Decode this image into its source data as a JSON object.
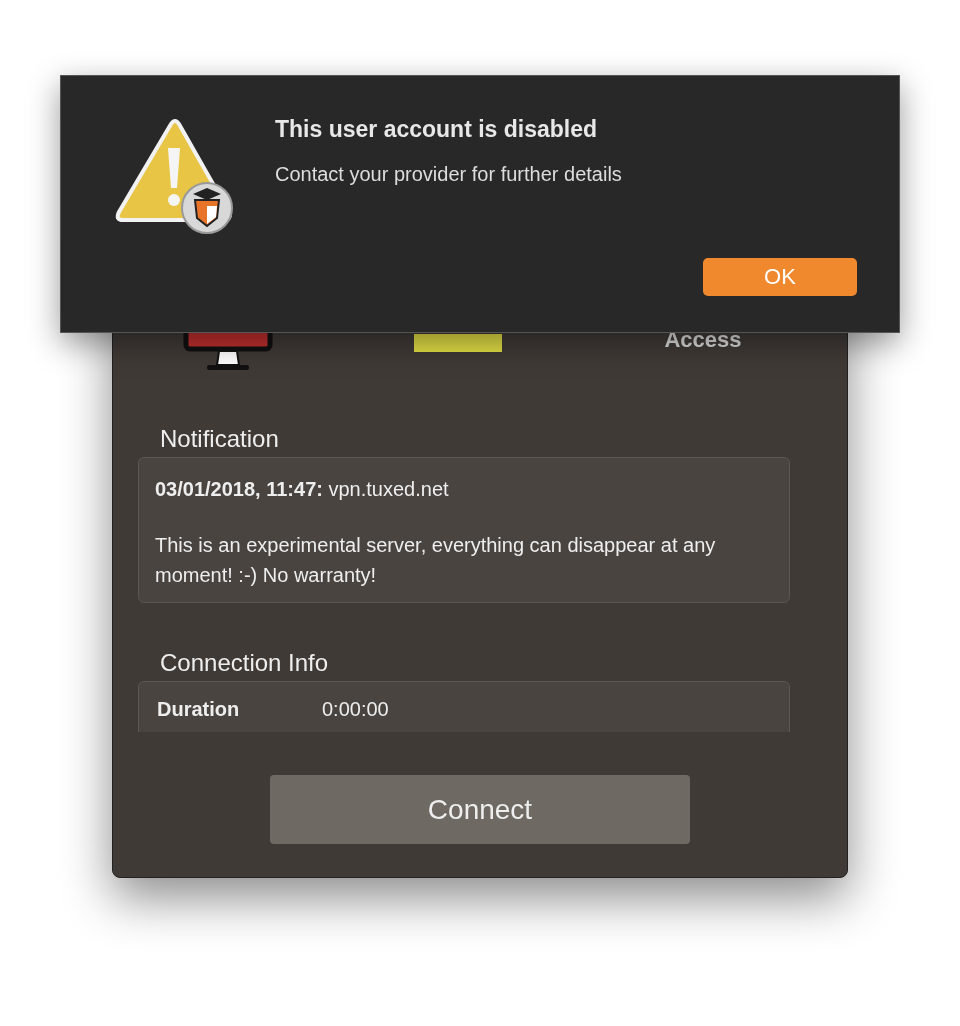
{
  "dialog": {
    "title": "This user account is disabled",
    "message": "Contact your provider for further details",
    "button": "OK"
  },
  "window": {
    "status_label": "Access",
    "notification": {
      "heading": "Notification",
      "lines": [
        "**03/01/2018, 11:47:** vpn.tuxed.net",
        "This is an experimental server, everything can disappear at any moment! :-) No warranty!"
      ]
    },
    "connection_info": {
      "heading": "Connection Info",
      "rows": [
        {
          "label": "Duration",
          "value": "0:00:00"
        }
      ]
    },
    "connect_button": "Connect"
  }
}
